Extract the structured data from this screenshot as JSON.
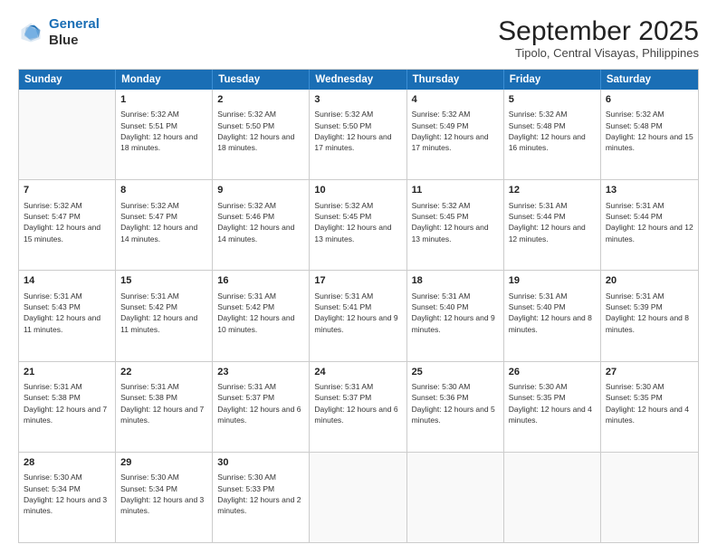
{
  "header": {
    "logo_line1": "General",
    "logo_line2": "Blue",
    "month": "September 2025",
    "location": "Tipolo, Central Visayas, Philippines"
  },
  "days": [
    "Sunday",
    "Monday",
    "Tuesday",
    "Wednesday",
    "Thursday",
    "Friday",
    "Saturday"
  ],
  "weeks": [
    [
      {
        "day": "",
        "empty": true
      },
      {
        "day": "1",
        "sunrise": "Sunrise: 5:32 AM",
        "sunset": "Sunset: 5:51 PM",
        "daylight": "Daylight: 12 hours and 18 minutes."
      },
      {
        "day": "2",
        "sunrise": "Sunrise: 5:32 AM",
        "sunset": "Sunset: 5:50 PM",
        "daylight": "Daylight: 12 hours and 18 minutes."
      },
      {
        "day": "3",
        "sunrise": "Sunrise: 5:32 AM",
        "sunset": "Sunset: 5:50 PM",
        "daylight": "Daylight: 12 hours and 17 minutes."
      },
      {
        "day": "4",
        "sunrise": "Sunrise: 5:32 AM",
        "sunset": "Sunset: 5:49 PM",
        "daylight": "Daylight: 12 hours and 17 minutes."
      },
      {
        "day": "5",
        "sunrise": "Sunrise: 5:32 AM",
        "sunset": "Sunset: 5:48 PM",
        "daylight": "Daylight: 12 hours and 16 minutes."
      },
      {
        "day": "6",
        "sunrise": "Sunrise: 5:32 AM",
        "sunset": "Sunset: 5:48 PM",
        "daylight": "Daylight: 12 hours and 15 minutes."
      }
    ],
    [
      {
        "day": "7",
        "sunrise": "Sunrise: 5:32 AM",
        "sunset": "Sunset: 5:47 PM",
        "daylight": "Daylight: 12 hours and 15 minutes."
      },
      {
        "day": "8",
        "sunrise": "Sunrise: 5:32 AM",
        "sunset": "Sunset: 5:47 PM",
        "daylight": "Daylight: 12 hours and 14 minutes."
      },
      {
        "day": "9",
        "sunrise": "Sunrise: 5:32 AM",
        "sunset": "Sunset: 5:46 PM",
        "daylight": "Daylight: 12 hours and 14 minutes."
      },
      {
        "day": "10",
        "sunrise": "Sunrise: 5:32 AM",
        "sunset": "Sunset: 5:45 PM",
        "daylight": "Daylight: 12 hours and 13 minutes."
      },
      {
        "day": "11",
        "sunrise": "Sunrise: 5:32 AM",
        "sunset": "Sunset: 5:45 PM",
        "daylight": "Daylight: 12 hours and 13 minutes."
      },
      {
        "day": "12",
        "sunrise": "Sunrise: 5:31 AM",
        "sunset": "Sunset: 5:44 PM",
        "daylight": "Daylight: 12 hours and 12 minutes."
      },
      {
        "day": "13",
        "sunrise": "Sunrise: 5:31 AM",
        "sunset": "Sunset: 5:44 PM",
        "daylight": "Daylight: 12 hours and 12 minutes."
      }
    ],
    [
      {
        "day": "14",
        "sunrise": "Sunrise: 5:31 AM",
        "sunset": "Sunset: 5:43 PM",
        "daylight": "Daylight: 12 hours and 11 minutes."
      },
      {
        "day": "15",
        "sunrise": "Sunrise: 5:31 AM",
        "sunset": "Sunset: 5:42 PM",
        "daylight": "Daylight: 12 hours and 11 minutes."
      },
      {
        "day": "16",
        "sunrise": "Sunrise: 5:31 AM",
        "sunset": "Sunset: 5:42 PM",
        "daylight": "Daylight: 12 hours and 10 minutes."
      },
      {
        "day": "17",
        "sunrise": "Sunrise: 5:31 AM",
        "sunset": "Sunset: 5:41 PM",
        "daylight": "Daylight: 12 hours and 9 minutes."
      },
      {
        "day": "18",
        "sunrise": "Sunrise: 5:31 AM",
        "sunset": "Sunset: 5:40 PM",
        "daylight": "Daylight: 12 hours and 9 minutes."
      },
      {
        "day": "19",
        "sunrise": "Sunrise: 5:31 AM",
        "sunset": "Sunset: 5:40 PM",
        "daylight": "Daylight: 12 hours and 8 minutes."
      },
      {
        "day": "20",
        "sunrise": "Sunrise: 5:31 AM",
        "sunset": "Sunset: 5:39 PM",
        "daylight": "Daylight: 12 hours and 8 minutes."
      }
    ],
    [
      {
        "day": "21",
        "sunrise": "Sunrise: 5:31 AM",
        "sunset": "Sunset: 5:38 PM",
        "daylight": "Daylight: 12 hours and 7 minutes."
      },
      {
        "day": "22",
        "sunrise": "Sunrise: 5:31 AM",
        "sunset": "Sunset: 5:38 PM",
        "daylight": "Daylight: 12 hours and 7 minutes."
      },
      {
        "day": "23",
        "sunrise": "Sunrise: 5:31 AM",
        "sunset": "Sunset: 5:37 PM",
        "daylight": "Daylight: 12 hours and 6 minutes."
      },
      {
        "day": "24",
        "sunrise": "Sunrise: 5:31 AM",
        "sunset": "Sunset: 5:37 PM",
        "daylight": "Daylight: 12 hours and 6 minutes."
      },
      {
        "day": "25",
        "sunrise": "Sunrise: 5:30 AM",
        "sunset": "Sunset: 5:36 PM",
        "daylight": "Daylight: 12 hours and 5 minutes."
      },
      {
        "day": "26",
        "sunrise": "Sunrise: 5:30 AM",
        "sunset": "Sunset: 5:35 PM",
        "daylight": "Daylight: 12 hours and 4 minutes."
      },
      {
        "day": "27",
        "sunrise": "Sunrise: 5:30 AM",
        "sunset": "Sunset: 5:35 PM",
        "daylight": "Daylight: 12 hours and 4 minutes."
      }
    ],
    [
      {
        "day": "28",
        "sunrise": "Sunrise: 5:30 AM",
        "sunset": "Sunset: 5:34 PM",
        "daylight": "Daylight: 12 hours and 3 minutes."
      },
      {
        "day": "29",
        "sunrise": "Sunrise: 5:30 AM",
        "sunset": "Sunset: 5:34 PM",
        "daylight": "Daylight: 12 hours and 3 minutes."
      },
      {
        "day": "30",
        "sunrise": "Sunrise: 5:30 AM",
        "sunset": "Sunset: 5:33 PM",
        "daylight": "Daylight: 12 hours and 2 minutes."
      },
      {
        "day": "",
        "empty": true
      },
      {
        "day": "",
        "empty": true
      },
      {
        "day": "",
        "empty": true
      },
      {
        "day": "",
        "empty": true
      }
    ]
  ]
}
